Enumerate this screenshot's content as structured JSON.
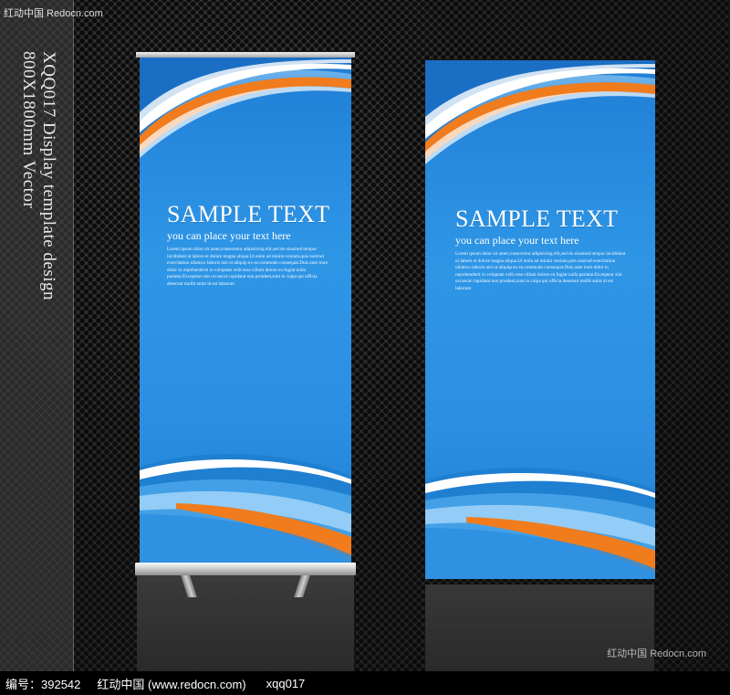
{
  "watermark": {
    "top_left": "红动中国 Redocn.com",
    "bottom_right": "红动中国 Redocn.com"
  },
  "vertical_title": {
    "line1": "XQQ017 Display template design",
    "line2": "800X1800mm Vector"
  },
  "banner_left": {
    "headline": "SAMPLE TEXT",
    "subline": "you can place your text here",
    "body": "Lorem ipsum dolor sit amet,consectetur adipisicing elit,sed do eiusmod tempor incididunt ut labore et dolore magna aliqua.Ut enim ad minim veniam,quis nostrud exercitation ullamco laboris nisi ut aliquip ex ea commodo consequat.Duis aute irure dolor in reprehenderit in voluptate velit esse cillum dolore eu fugiat nulla pariatur.Excepteur sint occaecat cupidatat non proident,sunt in culpa qui officia deserunt mollit anim id est laborum"
  },
  "banner_right": {
    "headline": "SAMPLE TEXT",
    "subline": "you can place your text here",
    "body": "Lorem ipsum dolor sit amet,consectetur adipisicing elit,sed do eiusmod tempor incididunt ut labore et dolore magna aliqua.Ut enim ad minim veniam,quis nostrud exercitation ullamco laboris nisi ut aliquip ex ea commodo consequat.Duis aute irure dolor in reprehenderit in voluptate velit esse cillum dolore eu fugiat nulla pariatur.Excepteur sint occaecat cupidatat non proident,sunt in culpa qui officia deserunt mollit anim id est laborum"
  },
  "footer": {
    "id_text": "编号：392542",
    "site_text": "红动中国 (www.redocn.com)",
    "code_text": "xqq017"
  },
  "colors": {
    "banner_blue": "#2a8de0",
    "accent_orange": "#f07c1e",
    "background_dark": "#262626"
  }
}
